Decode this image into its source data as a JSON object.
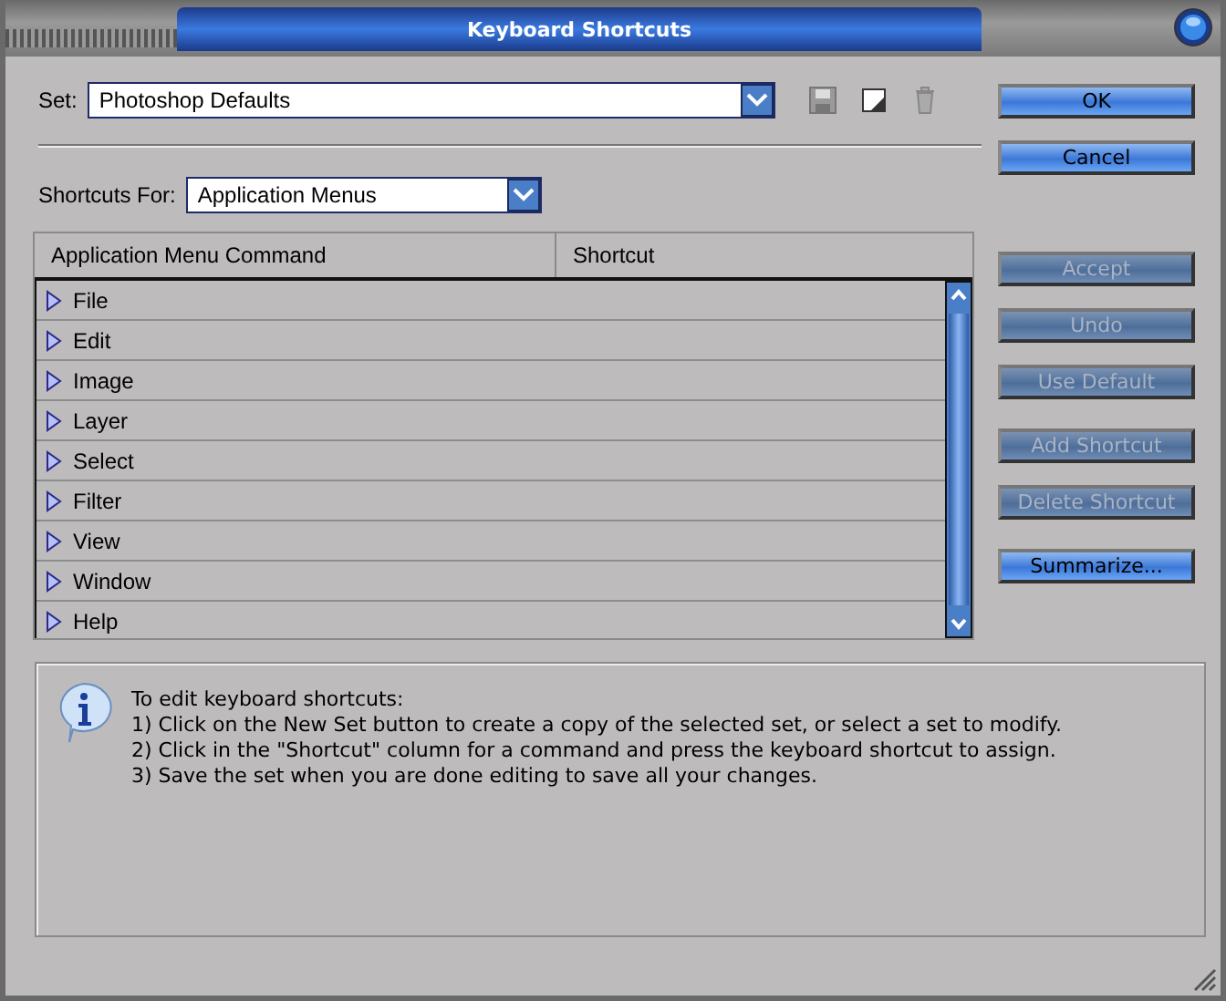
{
  "window": {
    "title": "Keyboard Shortcuts"
  },
  "set": {
    "label": "Set:",
    "value": "Photoshop Defaults"
  },
  "shortcuts_for": {
    "label": "Shortcuts For:",
    "value": "Application Menus"
  },
  "table": {
    "columns": [
      "Application Menu Command",
      "Shortcut"
    ],
    "rows": [
      {
        "label": "File",
        "expanded": false
      },
      {
        "label": "Edit",
        "expanded": false
      },
      {
        "label": "Image",
        "expanded": false
      },
      {
        "label": "Layer",
        "expanded": false
      },
      {
        "label": "Select",
        "expanded": false
      },
      {
        "label": "Filter",
        "expanded": false
      },
      {
        "label": "View",
        "expanded": false
      },
      {
        "label": "Window",
        "expanded": false
      },
      {
        "label": "Help",
        "expanded": false
      }
    ]
  },
  "button_groups": [
    [
      {
        "label": "OK",
        "disabled": false
      },
      {
        "label": "Cancel",
        "disabled": false
      }
    ],
    [
      {
        "label": "Accept",
        "disabled": true
      },
      {
        "label": "Undo",
        "disabled": true
      },
      {
        "label": "Use Default",
        "disabled": true
      }
    ],
    [
      {
        "label": "Add Shortcut",
        "disabled": true
      },
      {
        "label": "Delete Shortcut",
        "disabled": true
      }
    ],
    [
      {
        "label": "Summarize...",
        "disabled": false
      }
    ]
  ],
  "info": {
    "lines": [
      "To edit keyboard shortcuts:",
      "1) Click on the New Set button to create a copy of the selected set, or select a set to modify.",
      "2) Click in the \"Shortcut\" column for a command and press the keyboard shortcut to assign.",
      "3) Save the set when you are done editing to save all your changes."
    ]
  }
}
